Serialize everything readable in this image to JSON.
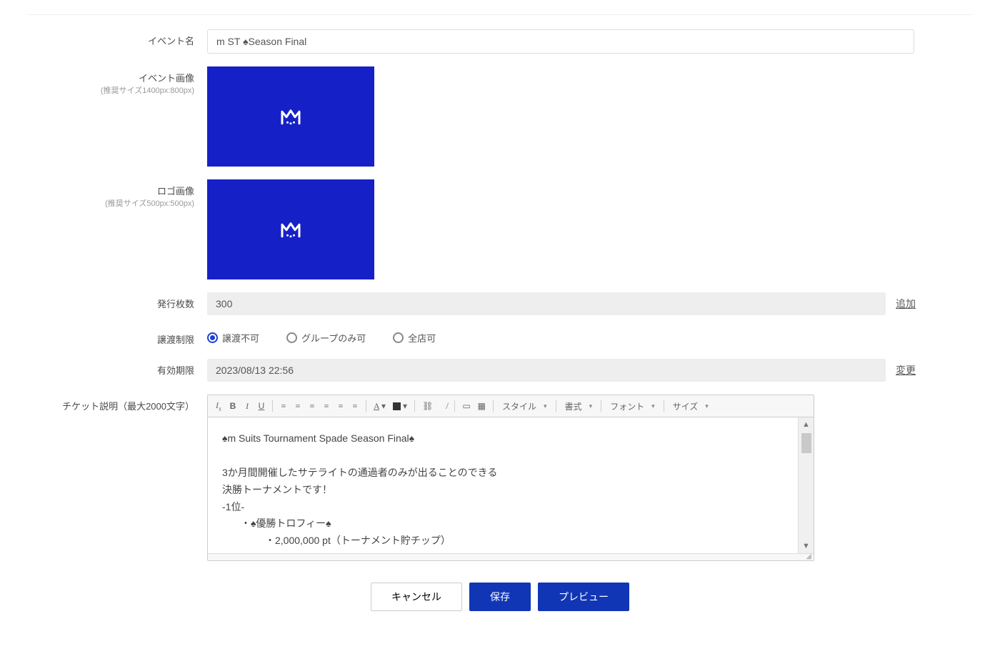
{
  "labels": {
    "event_name": "イベント名",
    "event_image": "イベント画像",
    "event_image_note": "(推奨サイズ1400px:800px)",
    "logo_image": "ロゴ画像",
    "logo_image_note": "(推奨サイズ500px:500px)",
    "issue_count": "発行枚数",
    "transfer_limit": "譲渡制限",
    "expiry": "有効期限",
    "ticket_desc": "チケット説明（最大2000文字）"
  },
  "values": {
    "event_name": "m ST ♠Season Final",
    "issue_count": "300",
    "expiry": "2023/08/13 22:56"
  },
  "links": {
    "add": "追加",
    "change": "変更"
  },
  "radio": {
    "opt1": "譲渡不可",
    "opt2": "グループのみ可",
    "opt3": "全店可"
  },
  "toolbar": {
    "style": "スタイル",
    "format": "書式",
    "font": "フォント",
    "size": "サイズ"
  },
  "editor": {
    "line1": "♠m Suits Tournament Spade  Season Final♠",
    "line2": "3か月間開催したサテライトの通過者のみが出ることのできる",
    "line3": "決勝トーナメントです！",
    "line4": "-1位-",
    "line5": "・♠優勝トロフィー♠",
    "line6": "・2,000,000 pt（トーナメント貯チップ）"
  },
  "buttons": {
    "cancel": "キャンセル",
    "save": "保存",
    "preview": "プレビュー"
  }
}
